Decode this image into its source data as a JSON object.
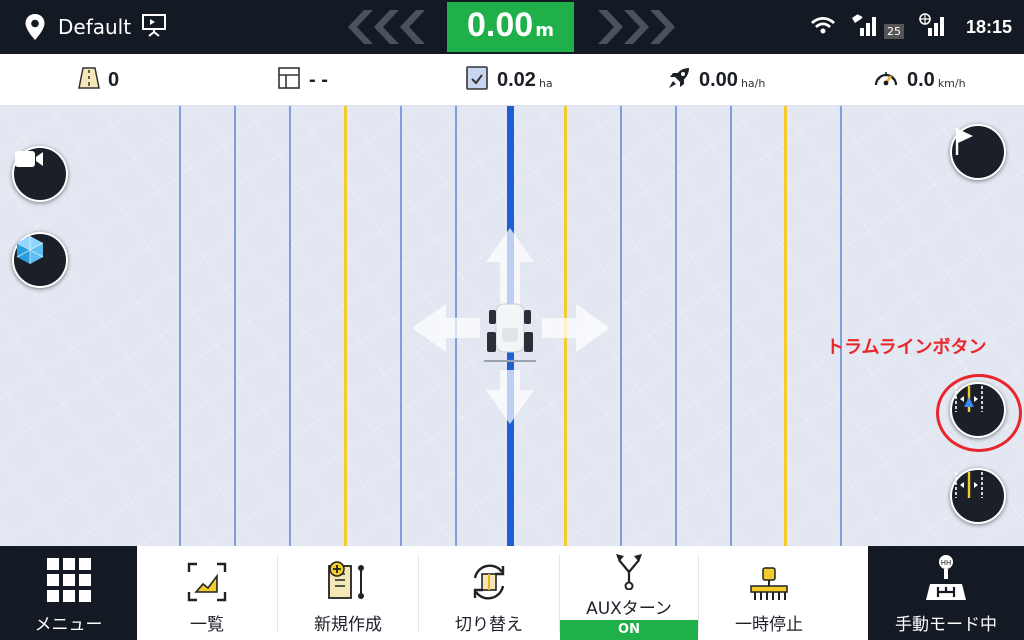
{
  "topbar": {
    "profile_name": "Default",
    "offset_value": "0.00",
    "offset_unit": "m",
    "satellite_count": "25",
    "time": "18:15"
  },
  "infobar": {
    "lines_count": "0",
    "block_value": "- -",
    "area_value": "0.02",
    "area_unit": "ha",
    "work_rate_value": "0.00",
    "work_rate_unit": "ha/h",
    "speed_value": "0.0",
    "speed_unit": "km/h"
  },
  "annotation": {
    "label": "トラムラインボタン"
  },
  "bottombar": {
    "menu_label": "メニュー",
    "list_label": "一覧",
    "new_label": "新規作成",
    "switch_label": "切り替え",
    "aux_label": "AUXターン",
    "aux_state": "ON",
    "pause_label": "一時停止",
    "manual_label": "手動モード中"
  },
  "colors": {
    "accent_green": "#1fb04a",
    "dark_bg": "#141a23",
    "guide_blue": "#1e5fd6",
    "line_blue": "#7f9ee0",
    "line_yellow": "#f2cc2c",
    "annotation_red": "#e8262b"
  }
}
